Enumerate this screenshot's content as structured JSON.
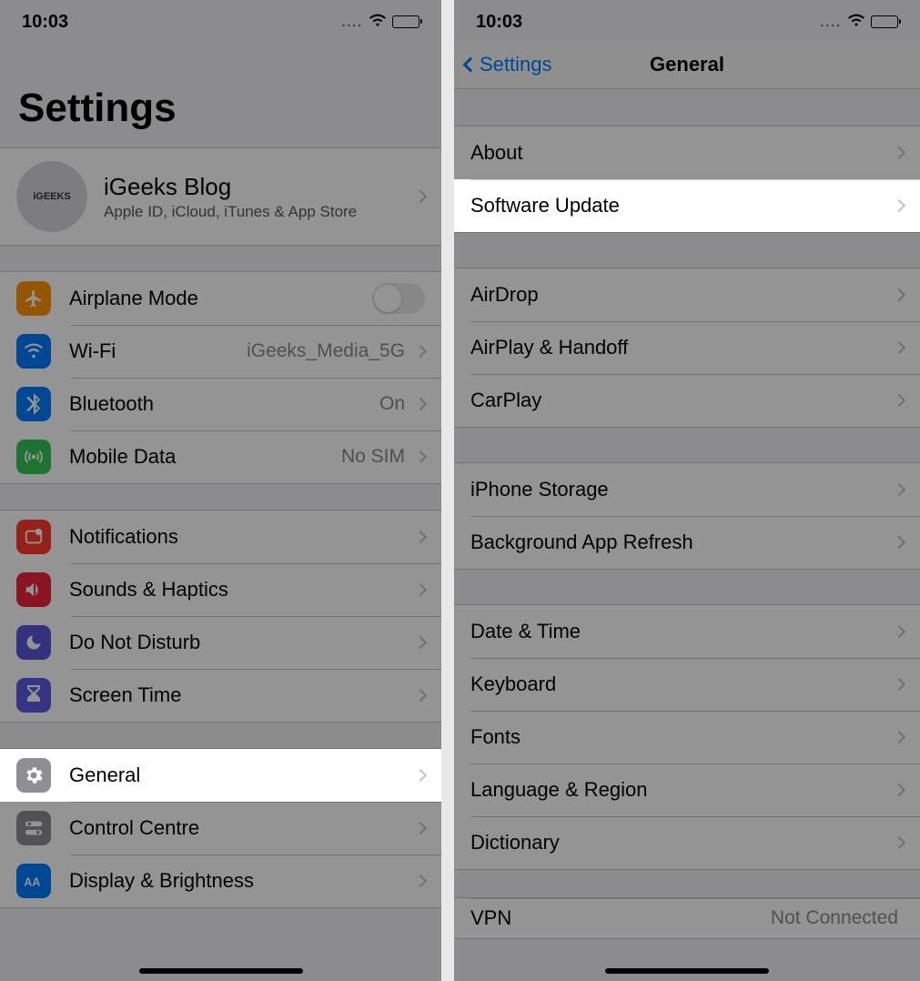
{
  "status": {
    "time": "10:03",
    "dots": "...."
  },
  "left": {
    "title": "Settings",
    "profile": {
      "avatar_text": "iGEEKS",
      "name": "iGeeks Blog",
      "subtitle": "Apple ID, iCloud, iTunes & App Store"
    },
    "g1": {
      "airplane": "Airplane Mode",
      "wifi": "Wi-Fi",
      "wifi_val": "iGeeks_Media_5G",
      "bluetooth": "Bluetooth",
      "bluetooth_val": "On",
      "mobile": "Mobile Data",
      "mobile_val": "No SIM"
    },
    "g2": {
      "notifications": "Notifications",
      "sounds": "Sounds & Haptics",
      "dnd": "Do Not Disturb",
      "screentime": "Screen Time"
    },
    "g3": {
      "general": "General",
      "control": "Control Centre",
      "display": "Display & Brightness"
    }
  },
  "right": {
    "back": "Settings",
    "title": "General",
    "g1": {
      "about": "About",
      "software": "Software Update"
    },
    "g2": {
      "airdrop": "AirDrop",
      "airplay": "AirPlay & Handoff",
      "carplay": "CarPlay"
    },
    "g3": {
      "storage": "iPhone Storage",
      "refresh": "Background App Refresh"
    },
    "g4": {
      "datetime": "Date & Time",
      "keyboard": "Keyboard",
      "fonts": "Fonts",
      "lang": "Language & Region",
      "dict": "Dictionary"
    },
    "g5": {
      "vpn": "VPN",
      "vpn_val": "Not Connected"
    }
  }
}
